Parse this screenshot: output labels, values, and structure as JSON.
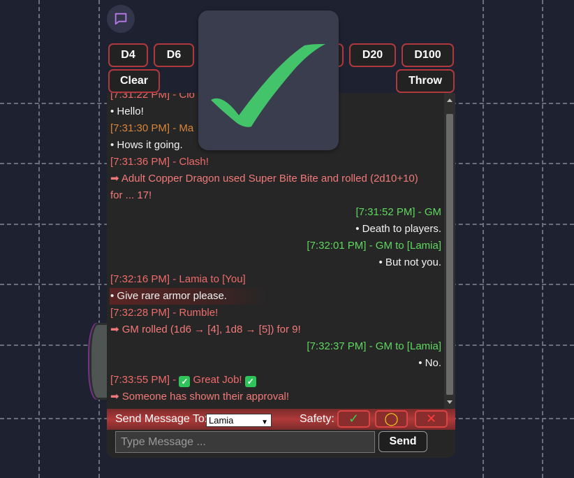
{
  "dice": {
    "d4": "D4",
    "d6": "D6",
    "d20": "D20",
    "d100": "D100",
    "clear": "Clear",
    "throw": "Throw"
  },
  "chat": {
    "messages": [
      {
        "text": "[7:31:22 PM] - Clo",
        "color": "#f06b6b"
      },
      {
        "text": "• Hello!",
        "color": "#f2f2f2"
      },
      {
        "text": "[7:31:30 PM] - Ma",
        "color": "#d9863b"
      },
      {
        "text": "• Hows it going.",
        "color": "#f2f2f2"
      },
      {
        "text": "[7:31:36 PM] - Clash!",
        "color": "#f06b6b"
      },
      {
        "text": "➡ Adult Copper Dragon used Super Bite Bite and rolled (2d10+10)",
        "color": "#f27a7a"
      },
      {
        "text": "for ... 17!",
        "color": "#f27a7a"
      },
      {
        "text": "[7:31:52 PM] - GM",
        "color": "#5fd85f"
      },
      {
        "text": "• Death to players.",
        "color": "#f2f2f2"
      },
      {
        "text": "[7:32:01 PM] - GM to [Lamia]",
        "color": "#5fd85f"
      },
      {
        "text": "• But not you.",
        "color": "#f2f2f2"
      },
      {
        "text": "[7:32:16 PM] - Lamia to [You]",
        "color": "#f06b6b"
      },
      {
        "text": "• Give rare armor please.",
        "color": "#f2f2f2"
      },
      {
        "text": "[7:32:28 PM] - Rumble!",
        "color": "#f06b6b"
      },
      {
        "text": "➡ GM rolled (1d6 → [4], 1d8 → [5]) for 9!",
        "color": "#f27a7a"
      },
      {
        "text": "[7:32:37 PM] - GM to [Lamia]",
        "color": "#5fd85f"
      },
      {
        "text": "• No.",
        "color": "#f2f2f2"
      },
      {
        "text_prefix": "[7:33:55 PM] - ",
        "text_mid": " Great Job! ",
        "color": "#f06b6b"
      },
      {
        "text": "➡ Someone has shown their approval!",
        "color": "#f27a7a"
      }
    ]
  },
  "send": {
    "label": "Send Message To:",
    "recipient": "Lamia",
    "safety_label": "Safety:",
    "safety_green": "✓",
    "safety_yellow": "◯",
    "safety_red": "✕",
    "placeholder": "Type Message ...",
    "button": "Send"
  },
  "colors": {
    "accent_red": "#b0393d",
    "gm_green": "#5fd85f",
    "approval_green": "#44c46a"
  },
  "icons": {
    "chat": "chat-bubble-icon",
    "approval": "checkmark-icon"
  }
}
